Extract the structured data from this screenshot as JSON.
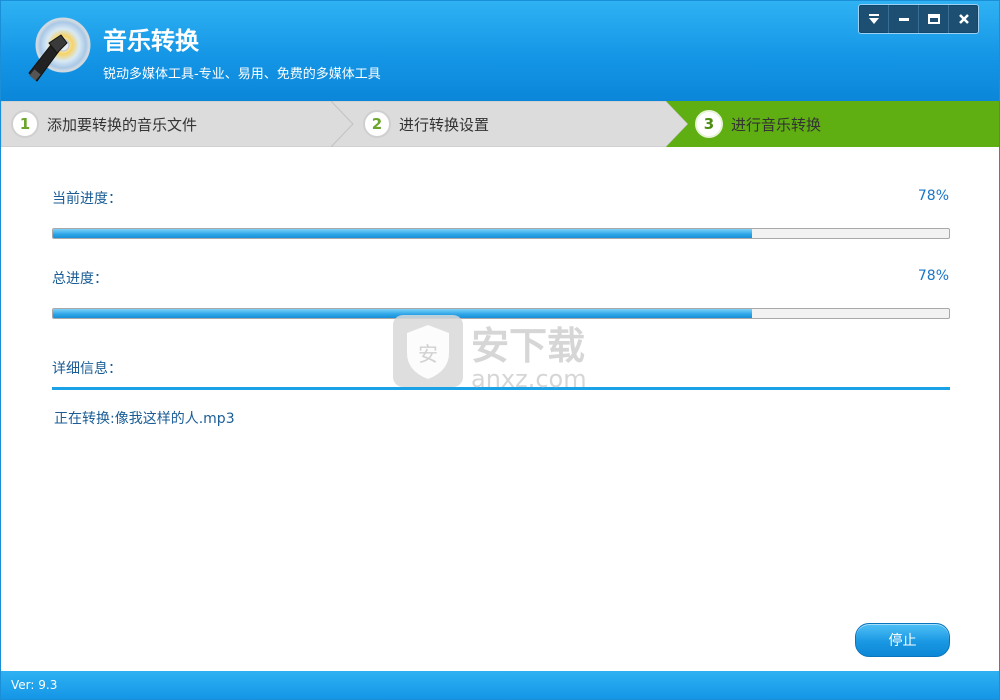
{
  "app": {
    "title": "音乐转换",
    "subtitle": "锐动多媒体工具-专业、易用、免费的多媒体工具",
    "version_label": "Ver: 9.3"
  },
  "window_controls": {
    "menu_icon": "dropdown-menu-icon",
    "minimize_icon": "minimize-icon",
    "maximize_icon": "maximize-icon",
    "close_icon": "close-icon"
  },
  "steps": [
    {
      "number": "1",
      "label": "添加要转换的音乐文件",
      "active": false
    },
    {
      "number": "2",
      "label": "进行转换设置",
      "active": false
    },
    {
      "number": "3",
      "label": "进行音乐转换",
      "active": true
    }
  ],
  "progress": {
    "current_label": "当前进度：",
    "current_percent": "78%",
    "current_value": 0.78,
    "total_label": "总进度：",
    "total_percent": "78%",
    "total_value": 0.78
  },
  "detail": {
    "label": "详细信息：",
    "message": "正在转换:像我这样的人.mp3"
  },
  "actions": {
    "stop_label": "停止"
  },
  "watermark": {
    "text_cn": "安下载",
    "text_en": "anxz.com"
  },
  "colors": {
    "header_blue": "#1596e6",
    "step_active_green": "#5fae12",
    "progress_blue": "#2ba4e7",
    "text_blue": "#1a5d96"
  }
}
